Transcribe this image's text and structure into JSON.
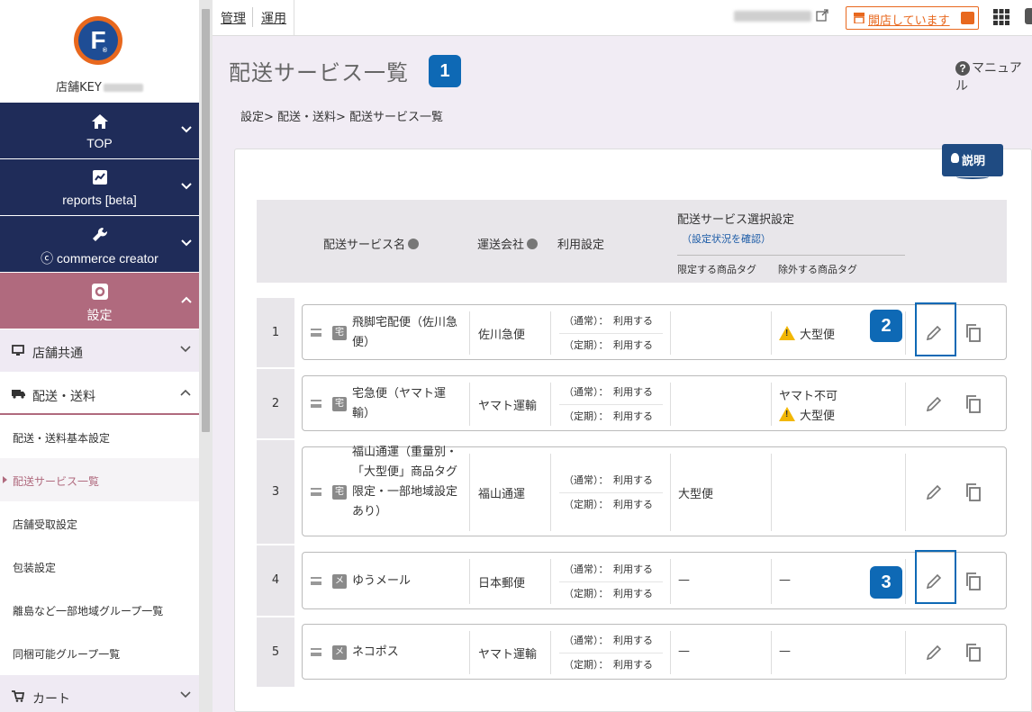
{
  "sidebar": {
    "shop_key_label": "店舗KEY",
    "main_nav": [
      {
        "label": "TOP",
        "icon": "home-icon"
      },
      {
        "label": "reports [beta]",
        "icon": "chart-icon"
      },
      {
        "label": "commerce creator",
        "icon": "wrench-icon"
      },
      {
        "label": "設定",
        "icon": "gear-icon"
      }
    ],
    "sub_nav": {
      "shop_common": "店舗共通",
      "shipping": "配送・送料",
      "cart": "カート"
    },
    "leaves": [
      "配送・送料基本設定",
      "配送サービス一覧",
      "店舗受取設定",
      "包装設定",
      "離島など一部地域グループ一覧",
      "同梱可能グループ一覧"
    ]
  },
  "topbar": {
    "links": [
      "管理",
      "運用"
    ],
    "open_status": "開店しています"
  },
  "page": {
    "title": "配送サービス一覧",
    "manual": "マニュアル",
    "breadcrumb": "設定> 配送・送料> 配送サービス一覧",
    "explain": "説明",
    "callouts": [
      "1",
      "2",
      "3"
    ]
  },
  "table": {
    "headers": {
      "service_name": "配送サービス名",
      "carrier": "運送会社",
      "usage": "利用設定",
      "selection": "配送サービス選択設定",
      "check_link": "（設定状況を確認）",
      "include_tag": "限定する商品タグ",
      "exclude_tag": "除外する商品タグ"
    },
    "rows": [
      {
        "num": "1",
        "type": "宅",
        "name": "飛脚宅配便（佐川急便）",
        "carrier": "佐川急便",
        "normal": "（通常）：　利用する",
        "regular": "（定期）：　利用する",
        "include": "",
        "exclude": "大型便",
        "exclude_warn": true,
        "exclude_prefix": ""
      },
      {
        "num": "2",
        "type": "宅",
        "name": "宅急便（ヤマト運輸）",
        "carrier": "ヤマト運輸",
        "normal": "（通常）：　利用する",
        "regular": "（定期）：　利用する",
        "include": "",
        "exclude": "大型便",
        "exclude_warn": true,
        "exclude_prefix": "ヤマト不可"
      },
      {
        "num": "3",
        "type": "宅",
        "name": "福山通運（重量別・「大型便」商品タグ限定・一部地域設定あり）",
        "carrier": "福山通運",
        "normal": "（通常）：　利用する",
        "regular": "（定期）：　利用する",
        "include": "大型便",
        "exclude": "",
        "exclude_warn": false,
        "exclude_prefix": ""
      },
      {
        "num": "4",
        "type": "メ",
        "name": "ゆうメール",
        "carrier": "日本郵便",
        "normal": "（通常）：　利用する",
        "regular": "（定期）：　利用する",
        "include": "—",
        "exclude": "—",
        "exclude_warn": false,
        "exclude_prefix": ""
      },
      {
        "num": "5",
        "type": "メ",
        "name": "ネコポス",
        "carrier": "ヤマト運輸",
        "normal": "（通常）：　利用する",
        "regular": "（定期）：　利用する",
        "include": "—",
        "exclude": "—",
        "exclude_warn": false,
        "exclude_prefix": ""
      }
    ]
  },
  "colors": {
    "nav_dark": "#1f2c59",
    "nav_active": "#b06a7e",
    "callout_blue": "#0e69b5",
    "accent_orange": "#e8681e"
  }
}
